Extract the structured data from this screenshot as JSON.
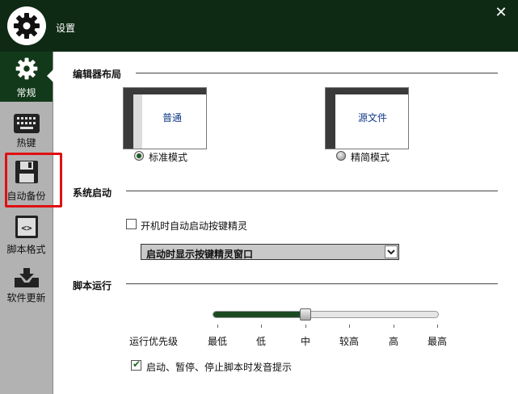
{
  "window": {
    "title": "设置"
  },
  "sidebar": {
    "items": [
      {
        "label": "常规",
        "icon": "gear-icon",
        "active": true
      },
      {
        "label": "热键",
        "icon": "keyboard-icon",
        "active": false
      },
      {
        "label": "自动备份",
        "icon": "floppy-disk-icon",
        "active": false
      },
      {
        "label": "脚本格式",
        "icon": "code-icon",
        "active": false
      },
      {
        "label": "软件更新",
        "icon": "download-icon",
        "active": false
      }
    ]
  },
  "editor_layout": {
    "heading": "编辑器布局",
    "options": [
      {
        "preview_text": "普通",
        "label": "标准模式",
        "selected": true
      },
      {
        "preview_text": "源文件",
        "label": "精简模式",
        "selected": false
      }
    ]
  },
  "startup": {
    "heading": "系统启动",
    "autostart": {
      "label": "开机时自动启动按键精灵",
      "checked": false
    },
    "startup_display": {
      "value": "启动时显示按键精灵窗口"
    }
  },
  "script_run": {
    "heading": "脚本运行",
    "priority": {
      "label": "运行优先级",
      "levels": [
        "最低",
        "低",
        "中",
        "较高",
        "高",
        "最高"
      ],
      "selected_index": 2
    },
    "sound": {
      "label": "启动、暂停、停止脚本时发音提示",
      "checked": true
    }
  },
  "colors": {
    "titlebar": "#0e2a14",
    "accent": "#1d5a26",
    "sidebar": "#b2b2b2",
    "highlight": "#e01010"
  }
}
